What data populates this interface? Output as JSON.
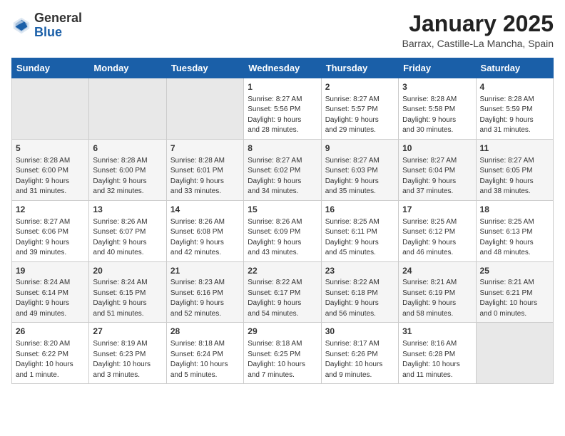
{
  "header": {
    "logo_general": "General",
    "logo_blue": "Blue",
    "month_title": "January 2025",
    "location": "Barrax, Castille-La Mancha, Spain"
  },
  "weekdays": [
    "Sunday",
    "Monday",
    "Tuesday",
    "Wednesday",
    "Thursday",
    "Friday",
    "Saturday"
  ],
  "weeks": [
    [
      {
        "day": "",
        "info": ""
      },
      {
        "day": "",
        "info": ""
      },
      {
        "day": "",
        "info": ""
      },
      {
        "day": "1",
        "info": "Sunrise: 8:27 AM\nSunset: 5:56 PM\nDaylight: 9 hours\nand 28 minutes."
      },
      {
        "day": "2",
        "info": "Sunrise: 8:27 AM\nSunset: 5:57 PM\nDaylight: 9 hours\nand 29 minutes."
      },
      {
        "day": "3",
        "info": "Sunrise: 8:28 AM\nSunset: 5:58 PM\nDaylight: 9 hours\nand 30 minutes."
      },
      {
        "day": "4",
        "info": "Sunrise: 8:28 AM\nSunset: 5:59 PM\nDaylight: 9 hours\nand 31 minutes."
      }
    ],
    [
      {
        "day": "5",
        "info": "Sunrise: 8:28 AM\nSunset: 6:00 PM\nDaylight: 9 hours\nand 31 minutes."
      },
      {
        "day": "6",
        "info": "Sunrise: 8:28 AM\nSunset: 6:00 PM\nDaylight: 9 hours\nand 32 minutes."
      },
      {
        "day": "7",
        "info": "Sunrise: 8:28 AM\nSunset: 6:01 PM\nDaylight: 9 hours\nand 33 minutes."
      },
      {
        "day": "8",
        "info": "Sunrise: 8:27 AM\nSunset: 6:02 PM\nDaylight: 9 hours\nand 34 minutes."
      },
      {
        "day": "9",
        "info": "Sunrise: 8:27 AM\nSunset: 6:03 PM\nDaylight: 9 hours\nand 35 minutes."
      },
      {
        "day": "10",
        "info": "Sunrise: 8:27 AM\nSunset: 6:04 PM\nDaylight: 9 hours\nand 37 minutes."
      },
      {
        "day": "11",
        "info": "Sunrise: 8:27 AM\nSunset: 6:05 PM\nDaylight: 9 hours\nand 38 minutes."
      }
    ],
    [
      {
        "day": "12",
        "info": "Sunrise: 8:27 AM\nSunset: 6:06 PM\nDaylight: 9 hours\nand 39 minutes."
      },
      {
        "day": "13",
        "info": "Sunrise: 8:26 AM\nSunset: 6:07 PM\nDaylight: 9 hours\nand 40 minutes."
      },
      {
        "day": "14",
        "info": "Sunrise: 8:26 AM\nSunset: 6:08 PM\nDaylight: 9 hours\nand 42 minutes."
      },
      {
        "day": "15",
        "info": "Sunrise: 8:26 AM\nSunset: 6:09 PM\nDaylight: 9 hours\nand 43 minutes."
      },
      {
        "day": "16",
        "info": "Sunrise: 8:25 AM\nSunset: 6:11 PM\nDaylight: 9 hours\nand 45 minutes."
      },
      {
        "day": "17",
        "info": "Sunrise: 8:25 AM\nSunset: 6:12 PM\nDaylight: 9 hours\nand 46 minutes."
      },
      {
        "day": "18",
        "info": "Sunrise: 8:25 AM\nSunset: 6:13 PM\nDaylight: 9 hours\nand 48 minutes."
      }
    ],
    [
      {
        "day": "19",
        "info": "Sunrise: 8:24 AM\nSunset: 6:14 PM\nDaylight: 9 hours\nand 49 minutes."
      },
      {
        "day": "20",
        "info": "Sunrise: 8:24 AM\nSunset: 6:15 PM\nDaylight: 9 hours\nand 51 minutes."
      },
      {
        "day": "21",
        "info": "Sunrise: 8:23 AM\nSunset: 6:16 PM\nDaylight: 9 hours\nand 52 minutes."
      },
      {
        "day": "22",
        "info": "Sunrise: 8:22 AM\nSunset: 6:17 PM\nDaylight: 9 hours\nand 54 minutes."
      },
      {
        "day": "23",
        "info": "Sunrise: 8:22 AM\nSunset: 6:18 PM\nDaylight: 9 hours\nand 56 minutes."
      },
      {
        "day": "24",
        "info": "Sunrise: 8:21 AM\nSunset: 6:19 PM\nDaylight: 9 hours\nand 58 minutes."
      },
      {
        "day": "25",
        "info": "Sunrise: 8:21 AM\nSunset: 6:21 PM\nDaylight: 10 hours\nand 0 minutes."
      }
    ],
    [
      {
        "day": "26",
        "info": "Sunrise: 8:20 AM\nSunset: 6:22 PM\nDaylight: 10 hours\nand 1 minute."
      },
      {
        "day": "27",
        "info": "Sunrise: 8:19 AM\nSunset: 6:23 PM\nDaylight: 10 hours\nand 3 minutes."
      },
      {
        "day": "28",
        "info": "Sunrise: 8:18 AM\nSunset: 6:24 PM\nDaylight: 10 hours\nand 5 minutes."
      },
      {
        "day": "29",
        "info": "Sunrise: 8:18 AM\nSunset: 6:25 PM\nDaylight: 10 hours\nand 7 minutes."
      },
      {
        "day": "30",
        "info": "Sunrise: 8:17 AM\nSunset: 6:26 PM\nDaylight: 10 hours\nand 9 minutes."
      },
      {
        "day": "31",
        "info": "Sunrise: 8:16 AM\nSunset: 6:28 PM\nDaylight: 10 hours\nand 11 minutes."
      },
      {
        "day": "",
        "info": ""
      }
    ]
  ]
}
